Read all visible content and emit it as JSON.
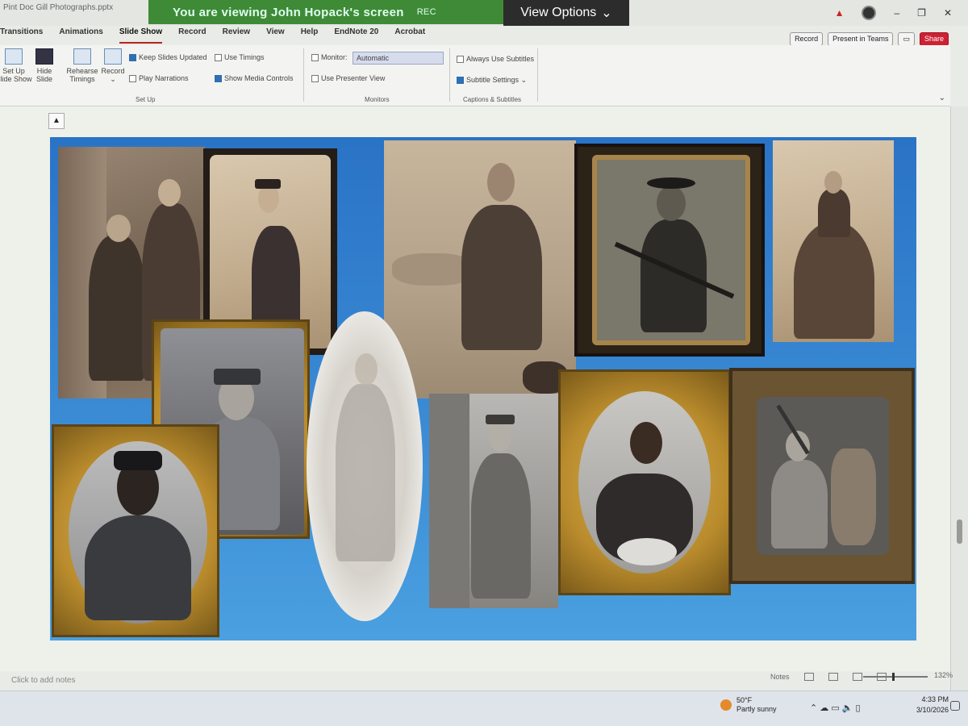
{
  "window": {
    "doc_title": "Pint Doc Gill Photographs.pptx",
    "minimize": "–",
    "restore": "❐",
    "close": "✕",
    "alert": "▲"
  },
  "zoom_banner": {
    "text": "You are viewing John Hopack's screen",
    "rec_label": "REC",
    "view_options": "View Options",
    "chevron": "⌄"
  },
  "ribbon_tabs": [
    "Transitions",
    "Animations",
    "Slide Show",
    "Record",
    "Review",
    "View",
    "Help",
    "EndNote 20",
    "Acrobat"
  ],
  "ribbon_tabs_active_index": 2,
  "ribbon_right": {
    "record": "Record",
    "present": "Present in Teams",
    "share": "Share"
  },
  "ribbon": {
    "setup_btn1": "Set Up\nSlide Show",
    "hide_slide": "Hide\nSlide",
    "rehearse": "Rehearse\nTimings",
    "record": "Record\n⌄",
    "keep_updated": "Keep Slides Updated",
    "play_narrations": "Play Narrations",
    "use_timings": "Use Timings",
    "show_media": "Show Media Controls",
    "group_setup": "Set Up",
    "monitor_label": "Monitor:",
    "monitor_value": "Automatic",
    "presenter_view": "Use Presenter View",
    "group_monitors": "Monitors",
    "always_subtitles": "Always Use Subtitles",
    "subtitle_settings": "Subtitle Settings ⌄",
    "group_captions": "Captions & Subtitles",
    "expand": "⌄"
  },
  "slide": {
    "collapse_icon": "▲"
  },
  "status": {
    "notes_placeholder": "Click to add notes",
    "notes_btn": "Notes",
    "zoom": "132%"
  },
  "taskbar": {
    "weather_temp": "50°F",
    "weather_desc": "Partly sunny",
    "time": "4:33 PM",
    "date": "3/10/2026",
    "tray": "⌃  ☁  ▭  🔈  ▯"
  }
}
